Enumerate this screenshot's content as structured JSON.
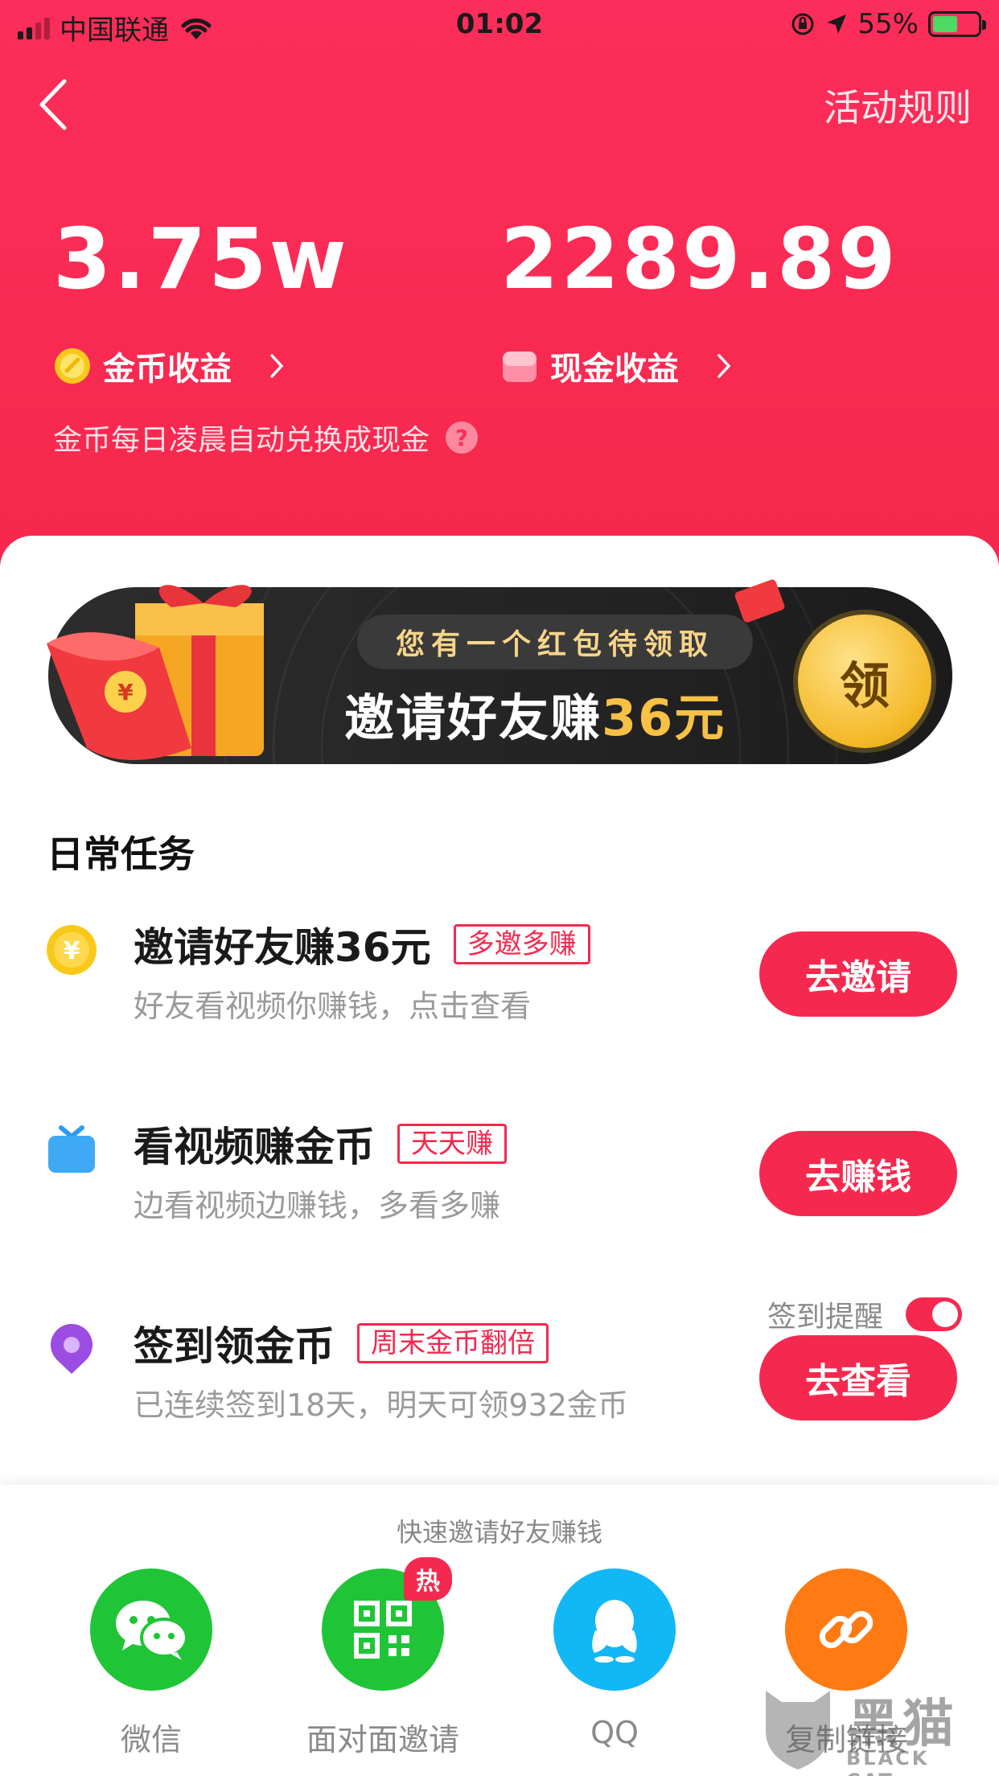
{
  "status_bar": {
    "carrier": "中国联通",
    "time": "01:02",
    "battery": "55%",
    "battery_level": 0.55
  },
  "header": {
    "rules_label": "活动规则"
  },
  "earnings": {
    "coin_value": "3.75w",
    "coin_label": "金币收益",
    "cash_value": "2289.89",
    "cash_label": "现金收益",
    "note": "金币每日凌晨自动兑换成现金",
    "help": "?"
  },
  "banner": {
    "pill": "您有一个红包待领取",
    "headline_prefix": "邀请好友赚",
    "headline_amount": "36元",
    "claim": "领"
  },
  "tasks": {
    "section_title": "日常任务",
    "items": [
      {
        "title": "邀请好友赚36元",
        "tag": "多邀多赚",
        "desc": "好友看视频你赚钱，点击查看",
        "button": "去邀请",
        "icon": "gold-coin-icon"
      },
      {
        "title": "看视频赚金币",
        "tag": "天天赚",
        "desc": "边看视频边赚钱，多看多赚",
        "button": "去赚钱",
        "icon": "tv-icon"
      },
      {
        "title": "签到领金币",
        "tag": "周末金币翻倍",
        "desc": "已连续签到18天，明天可领932金币",
        "button": "去查看",
        "icon": "location-pin-icon"
      }
    ],
    "reminder_label": "签到提醒",
    "reminder_on": true
  },
  "share": {
    "title": "快速邀请好友赚钱",
    "items": [
      {
        "label": "微信",
        "color": "#1fc536",
        "icon": "wechat-icon"
      },
      {
        "label": "面对面邀请",
        "color": "#1fc536",
        "icon": "qr-code-icon",
        "badge": "热"
      },
      {
        "label": "QQ",
        "color": "#12b7f5",
        "icon": "qq-penguin-icon"
      },
      {
        "label": "复制链接",
        "color": "#ff7a12",
        "icon": "link-icon"
      }
    ]
  },
  "watermark": {
    "text": "黑猫",
    "sub": "BLACK CAT"
  },
  "colors": {
    "header": "#fc2d5a",
    "accent": "#f5294f",
    "gold": "#f6c145"
  }
}
